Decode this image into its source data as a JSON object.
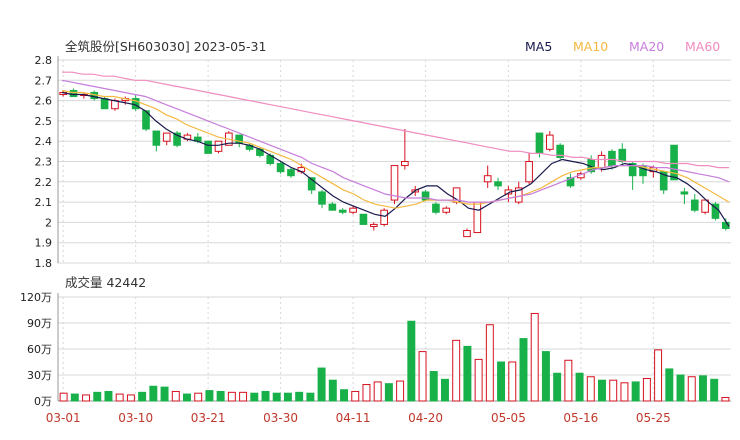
{
  "header": {
    "title": "全筑股份[SH603030] 2023-05-31",
    "legend": [
      {
        "label": "MA5",
        "color": "#1a1a4e"
      },
      {
        "label": "MA10",
        "color": "#f5b942"
      },
      {
        "label": "MA20",
        "color": "#c77ddb"
      },
      {
        "label": "MA60",
        "color": "#f08cc0"
      }
    ]
  },
  "colors": {
    "up": "#d6111e",
    "down": "#18b048",
    "grid": "#d8d8d8",
    "axis": "#999999"
  },
  "chart_data": [
    {
      "type": "candlestick",
      "title": "全筑股份[SH603030] 2023-05-31",
      "ylim": [
        1.8,
        2.8
      ],
      "yticks": [
        "2.8",
        "2.7",
        "2.6",
        "2.5",
        "2.4",
        "2.3",
        "2.2",
        "2.1",
        "2",
        "1.9",
        "1.8"
      ],
      "x": [
        "03-01",
        "03-02",
        "03-03",
        "03-06",
        "03-07",
        "03-08",
        "03-09",
        "03-10",
        "03-13",
        "03-14",
        "03-15",
        "03-16",
        "03-17",
        "03-20",
        "03-21",
        "03-22",
        "03-23",
        "03-24",
        "03-27",
        "03-28",
        "03-29",
        "03-30",
        "03-31",
        "04-03",
        "04-04",
        "04-06",
        "04-07",
        "04-10",
        "04-11",
        "04-12",
        "04-13",
        "04-14",
        "04-17",
        "04-18",
        "04-19",
        "04-20",
        "04-21",
        "04-24",
        "04-25",
        "04-26",
        "04-27",
        "04-28",
        "05-04",
        "05-05",
        "05-08",
        "05-09",
        "05-10",
        "05-11",
        "05-12",
        "05-15",
        "05-16",
        "05-17",
        "05-18",
        "05-19",
        "05-22",
        "05-23",
        "05-24",
        "05-25",
        "05-26",
        "05-29",
        "05-30",
        "05-31"
      ],
      "xticks": [
        "03-01",
        "03-10",
        "03-21",
        "03-30",
        "04-11",
        "04-20",
        "05-05",
        "05-16",
        "05-25"
      ],
      "ohlc": [
        [
          2.63,
          2.65,
          2.62,
          2.64
        ],
        [
          2.65,
          2.66,
          2.62,
          2.62
        ],
        [
          2.63,
          2.64,
          2.61,
          2.63
        ],
        [
          2.64,
          2.65,
          2.6,
          2.61
        ],
        [
          2.61,
          2.62,
          2.56,
          2.56
        ],
        [
          2.56,
          2.61,
          2.55,
          2.6
        ],
        [
          2.6,
          2.62,
          2.58,
          2.61
        ],
        [
          2.61,
          2.63,
          2.55,
          2.56
        ],
        [
          2.55,
          2.55,
          2.45,
          2.46
        ],
        [
          2.45,
          2.45,
          2.35,
          2.38
        ],
        [
          2.4,
          2.44,
          2.38,
          2.44
        ],
        [
          2.44,
          2.45,
          2.37,
          2.38
        ],
        [
          2.41,
          2.44,
          2.4,
          2.43
        ],
        [
          2.42,
          2.44,
          2.39,
          2.4
        ],
        [
          2.4,
          2.4,
          2.34,
          2.34
        ],
        [
          2.35,
          2.4,
          2.34,
          2.4
        ],
        [
          2.38,
          2.45,
          2.38,
          2.44
        ],
        [
          2.43,
          2.43,
          2.37,
          2.39
        ],
        [
          2.38,
          2.39,
          2.35,
          2.36
        ],
        [
          2.36,
          2.37,
          2.32,
          2.33
        ],
        [
          2.33,
          2.34,
          2.28,
          2.29
        ],
        [
          2.29,
          2.3,
          2.24,
          2.25
        ],
        [
          2.26,
          2.27,
          2.22,
          2.23
        ],
        [
          2.25,
          2.29,
          2.24,
          2.27
        ],
        [
          2.22,
          2.22,
          2.14,
          2.16
        ],
        [
          2.15,
          2.16,
          2.07,
          2.09
        ],
        [
          2.09,
          2.1,
          2.06,
          2.06
        ],
        [
          2.06,
          2.07,
          2.04,
          2.05
        ],
        [
          2.05,
          2.08,
          2.04,
          2.07
        ],
        [
          2.04,
          2.04,
          1.99,
          1.99
        ],
        [
          1.98,
          2.0,
          1.96,
          1.99
        ],
        [
          1.99,
          2.07,
          1.98,
          2.06
        ],
        [
          2.11,
          2.28,
          2.09,
          2.28
        ],
        [
          2.28,
          2.46,
          2.26,
          2.3
        ],
        [
          2.15,
          2.18,
          2.13,
          2.16
        ],
        [
          2.15,
          2.16,
          2.11,
          2.11
        ],
        [
          2.09,
          2.1,
          2.04,
          2.05
        ],
        [
          2.05,
          2.08,
          2.04,
          2.07
        ],
        [
          2.1,
          2.17,
          2.09,
          2.17
        ],
        [
          1.93,
          1.97,
          1.93,
          1.96
        ],
        [
          1.95,
          2.1,
          1.95,
          2.1
        ],
        [
          2.2,
          2.28,
          2.17,
          2.23
        ],
        [
          2.2,
          2.22,
          2.16,
          2.18
        ],
        [
          2.14,
          2.18,
          2.1,
          2.16
        ],
        [
          2.1,
          2.2,
          2.09,
          2.17
        ],
        [
          2.2,
          2.34,
          2.19,
          2.3
        ],
        [
          2.44,
          2.44,
          2.32,
          2.34
        ],
        [
          2.36,
          2.45,
          2.35,
          2.43
        ],
        [
          2.38,
          2.39,
          2.31,
          2.32
        ],
        [
          2.22,
          2.24,
          2.17,
          2.18
        ],
        [
          2.22,
          2.25,
          2.21,
          2.24
        ],
        [
          2.31,
          2.33,
          2.24,
          2.25
        ],
        [
          2.27,
          2.35,
          2.25,
          2.33
        ],
        [
          2.35,
          2.36,
          2.26,
          2.28
        ],
        [
          2.36,
          2.39,
          2.29,
          2.3
        ],
        [
          2.29,
          2.3,
          2.16,
          2.23
        ],
        [
          2.28,
          2.29,
          2.19,
          2.23
        ],
        [
          2.25,
          2.28,
          2.22,
          2.27
        ],
        [
          2.25,
          2.25,
          2.14,
          2.16
        ],
        [
          2.38,
          2.38,
          2.21,
          2.21
        ],
        [
          2.15,
          2.17,
          2.09,
          2.14
        ],
        [
          2.11,
          2.14,
          2.05,
          2.06
        ],
        [
          2.05,
          2.11,
          2.04,
          2.11
        ],
        [
          2.09,
          2.1,
          2.01,
          2.02
        ],
        [
          2.0,
          2.02,
          1.96,
          1.97
        ]
      ],
      "ma": {
        "MA5": [
          2.64,
          2.63,
          2.63,
          2.62,
          2.61,
          2.6,
          2.59,
          2.58,
          2.55,
          2.5,
          2.46,
          2.43,
          2.41,
          2.4,
          2.38,
          2.38,
          2.39,
          2.39,
          2.38,
          2.36,
          2.33,
          2.3,
          2.27,
          2.25,
          2.21,
          2.17,
          2.13,
          2.1,
          2.08,
          2.06,
          2.04,
          2.03,
          2.07,
          2.12,
          2.16,
          2.18,
          2.18,
          2.14,
          2.11,
          2.07,
          2.06,
          2.09,
          2.12,
          2.15,
          2.16,
          2.19,
          2.24,
          2.29,
          2.31,
          2.3,
          2.29,
          2.27,
          2.26,
          2.27,
          2.29,
          2.28,
          2.26,
          2.25,
          2.23,
          2.22,
          2.19,
          2.15,
          2.1,
          2.06,
          1.98
        ],
        "MA10": [
          2.65,
          2.64,
          2.64,
          2.63,
          2.62,
          2.62,
          2.61,
          2.6,
          2.58,
          2.56,
          2.53,
          2.51,
          2.48,
          2.46,
          2.44,
          2.42,
          2.41,
          2.4,
          2.39,
          2.37,
          2.35,
          2.33,
          2.31,
          2.28,
          2.25,
          2.22,
          2.19,
          2.16,
          2.14,
          2.11,
          2.09,
          2.08,
          2.07,
          2.08,
          2.09,
          2.11,
          2.11,
          2.11,
          2.1,
          2.09,
          2.09,
          2.1,
          2.11,
          2.12,
          2.13,
          2.15,
          2.17,
          2.2,
          2.23,
          2.25,
          2.26,
          2.27,
          2.27,
          2.28,
          2.28,
          2.28,
          2.27,
          2.26,
          2.25,
          2.24,
          2.22,
          2.19,
          2.16,
          2.13,
          2.1
        ],
        "MA20": [
          2.7,
          2.69,
          2.68,
          2.67,
          2.66,
          2.65,
          2.64,
          2.63,
          2.62,
          2.6,
          2.58,
          2.56,
          2.54,
          2.52,
          2.5,
          2.48,
          2.46,
          2.44,
          2.42,
          2.4,
          2.38,
          2.36,
          2.34,
          2.32,
          2.29,
          2.27,
          2.25,
          2.22,
          2.2,
          2.18,
          2.16,
          2.14,
          2.13,
          2.12,
          2.12,
          2.12,
          2.11,
          2.11,
          2.11,
          2.1,
          2.1,
          2.1,
          2.11,
          2.12,
          2.13,
          2.14,
          2.16,
          2.18,
          2.2,
          2.22,
          2.24,
          2.26,
          2.27,
          2.28,
          2.28,
          2.28,
          2.28,
          2.27,
          2.27,
          2.26,
          2.25,
          2.24,
          2.23,
          2.22,
          2.2
        ],
        "MA60": [
          2.74,
          2.74,
          2.73,
          2.73,
          2.72,
          2.72,
          2.71,
          2.7,
          2.7,
          2.69,
          2.68,
          2.67,
          2.66,
          2.65,
          2.64,
          2.63,
          2.62,
          2.61,
          2.6,
          2.59,
          2.58,
          2.57,
          2.56,
          2.55,
          2.54,
          2.53,
          2.52,
          2.51,
          2.5,
          2.49,
          2.48,
          2.47,
          2.46,
          2.45,
          2.44,
          2.43,
          2.42,
          2.41,
          2.4,
          2.39,
          2.38,
          2.37,
          2.36,
          2.35,
          2.35,
          2.34,
          2.34,
          2.33,
          2.33,
          2.32,
          2.32,
          2.31,
          2.31,
          2.31,
          2.3,
          2.3,
          2.3,
          2.3,
          2.29,
          2.29,
          2.29,
          2.28,
          2.28,
          2.27,
          2.27
        ]
      }
    },
    {
      "type": "bar",
      "title": "成交量 42442",
      "ylim": [
        0,
        120
      ],
      "yticks": [
        "120万",
        "90万",
        "60万",
        "30万",
        "0万"
      ],
      "values": [
        9,
        8,
        7,
        10,
        11,
        8,
        7,
        10,
        17,
        16,
        11,
        8,
        9,
        12,
        11,
        10,
        10,
        9,
        11,
        9,
        9,
        10,
        9,
        38,
        24,
        13,
        11,
        19,
        22,
        20,
        23,
        92,
        57,
        34,
        25,
        70,
        63,
        48,
        88,
        45,
        45,
        72,
        101,
        57,
        32,
        47,
        32,
        28,
        24,
        24,
        21,
        22,
        26,
        59,
        37,
        30,
        28,
        29,
        25,
        4
      ],
      "dir": [
        "u",
        "d",
        "u",
        "d",
        "d",
        "u",
        "u",
        "d",
        "d",
        "d",
        "u",
        "d",
        "u",
        "d",
        "d",
        "u",
        "u",
        "d",
        "d",
        "d",
        "d",
        "d",
        "d",
        "d",
        "d",
        "d",
        "u",
        "u",
        "u",
        "d",
        "u",
        "d",
        "u",
        "d",
        "d",
        "u",
        "d",
        "u",
        "u",
        "d",
        "u",
        "d",
        "u",
        "d",
        "d",
        "u",
        "d",
        "u",
        "d",
        "u",
        "u",
        "d",
        "u",
        "u",
        "d",
        "d",
        "u",
        "d",
        "d",
        "u"
      ]
    }
  ]
}
